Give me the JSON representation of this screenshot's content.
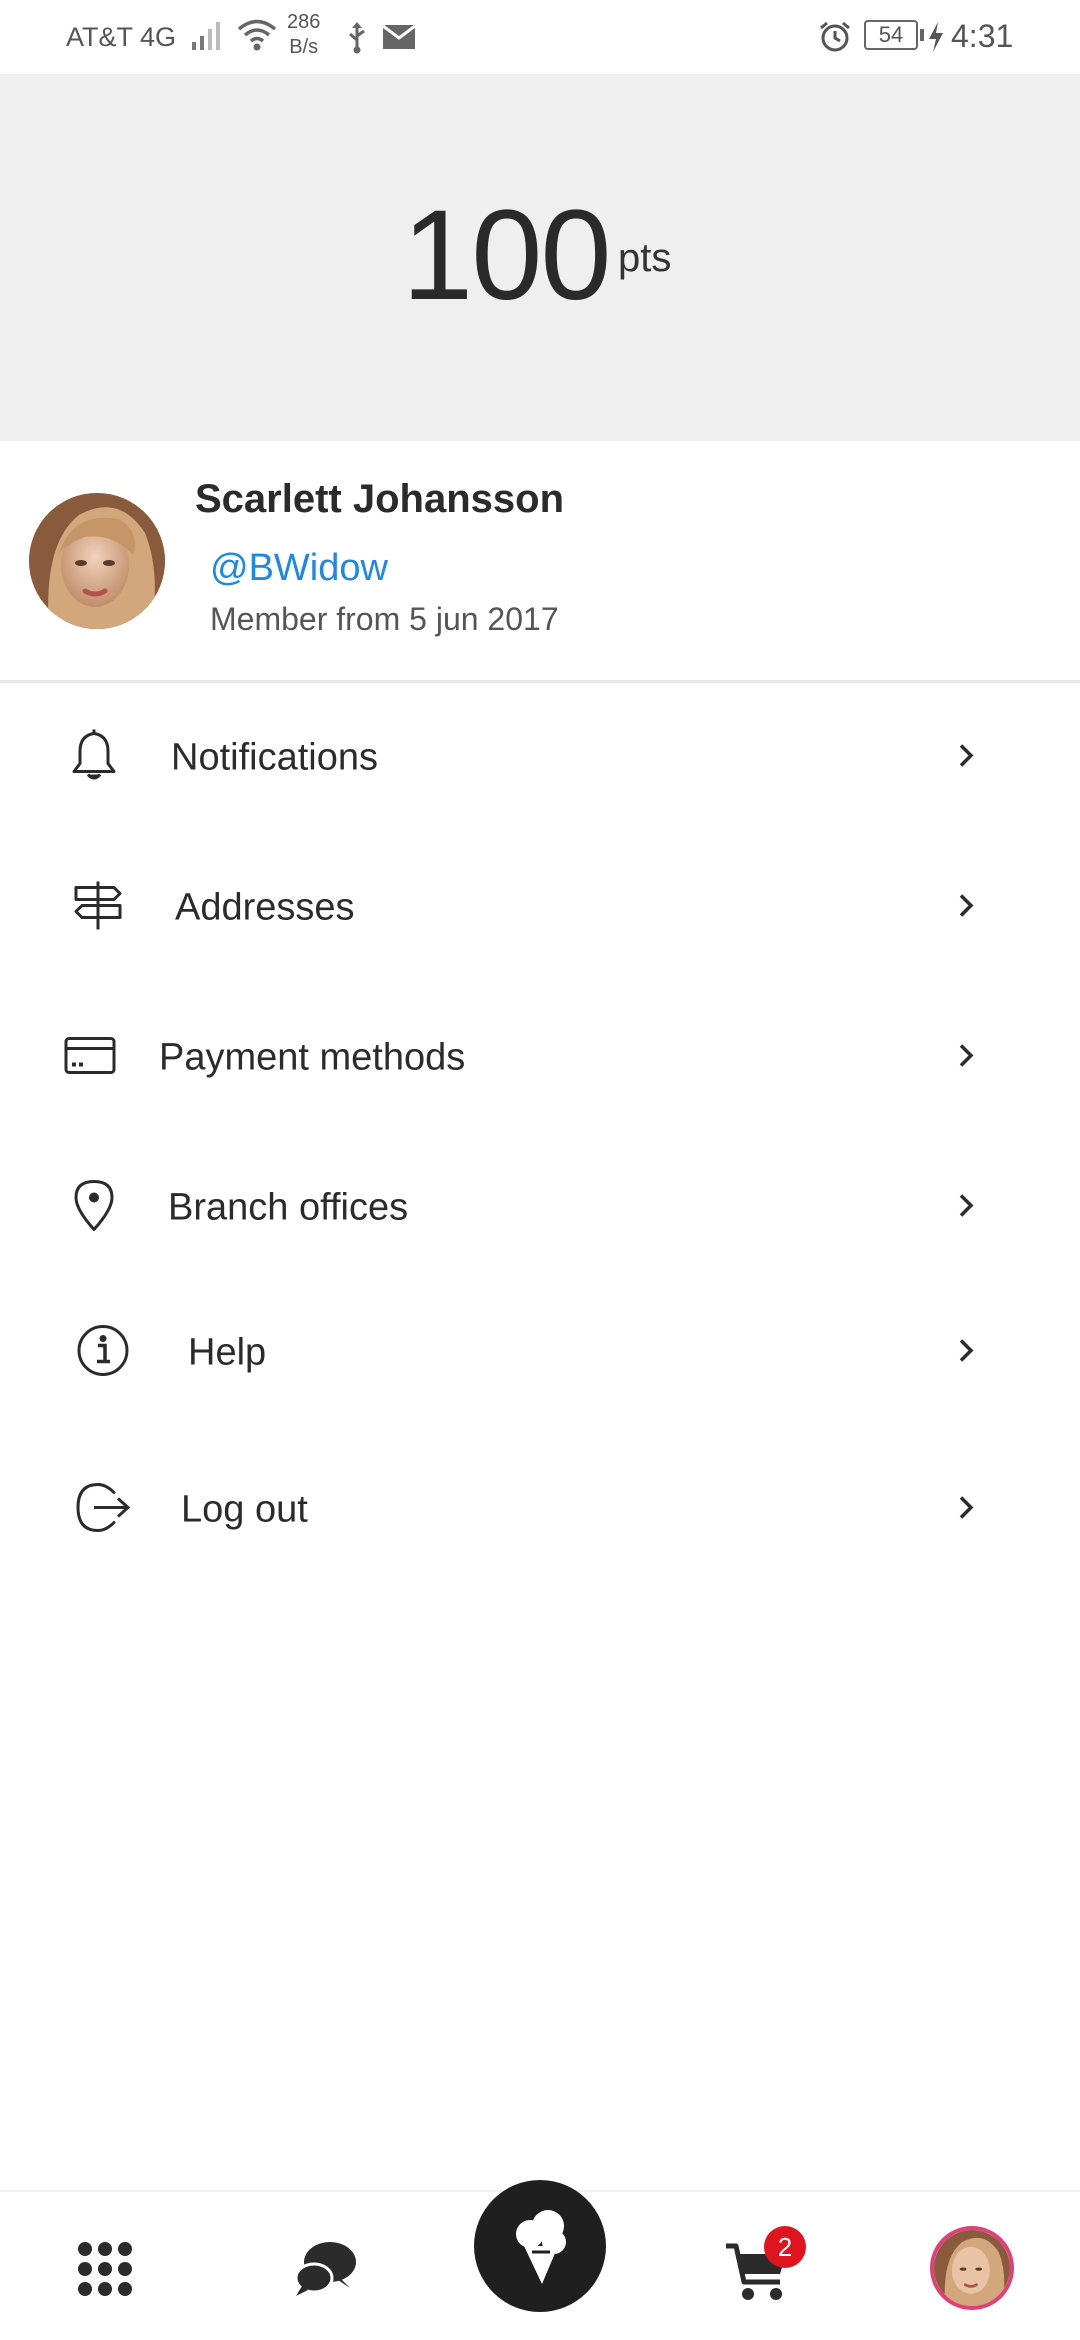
{
  "status_bar": {
    "carrier": "AT&T 4G",
    "net_speed_value": "286",
    "net_speed_unit": "B/s",
    "battery_level": "54",
    "time": "4:31",
    "icons": [
      "signal-icon",
      "wifi-icon",
      "usb-icon",
      "mail-icon",
      "alarm-icon",
      "battery-icon",
      "charging-icon"
    ]
  },
  "points": {
    "value": "100",
    "unit": "pts"
  },
  "profile": {
    "name": "Scarlett Johansson",
    "handle": "@BWidow",
    "member_since": "Member from 5 jun 2017"
  },
  "menu": {
    "items": [
      {
        "label": "Notifications",
        "icon": "bell-icon"
      },
      {
        "label": "Addresses",
        "icon": "signpost-icon"
      },
      {
        "label": "Payment methods",
        "icon": "credit-card-icon"
      },
      {
        "label": "Branch offices",
        "icon": "location-pin-icon"
      },
      {
        "label": "Help",
        "icon": "info-icon"
      },
      {
        "label": "Log out",
        "icon": "logout-icon"
      }
    ]
  },
  "bottom_nav": {
    "items": [
      "grid-menu-icon",
      "chat-icon",
      "ice-cream-icon",
      "cart-icon",
      "profile-avatar"
    ],
    "cart_count": "2"
  },
  "colors": {
    "accent_link": "#1e88e5",
    "hero_bg": "#efefef",
    "badge": "#e0141e",
    "fab": "#1f1f1f"
  }
}
